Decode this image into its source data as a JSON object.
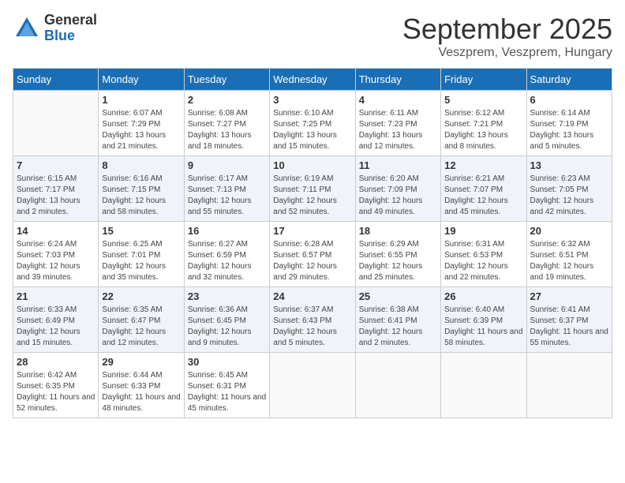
{
  "logo": {
    "general": "General",
    "blue": "Blue"
  },
  "header": {
    "month": "September 2025",
    "location": "Veszprem, Veszprem, Hungary"
  },
  "weekdays": [
    "Sunday",
    "Monday",
    "Tuesday",
    "Wednesday",
    "Thursday",
    "Friday",
    "Saturday"
  ],
  "weeks": [
    [
      {
        "day": "",
        "sunrise": "",
        "sunset": "",
        "daylight": ""
      },
      {
        "day": "1",
        "sunrise": "Sunrise: 6:07 AM",
        "sunset": "Sunset: 7:29 PM",
        "daylight": "Daylight: 13 hours and 21 minutes."
      },
      {
        "day": "2",
        "sunrise": "Sunrise: 6:08 AM",
        "sunset": "Sunset: 7:27 PM",
        "daylight": "Daylight: 13 hours and 18 minutes."
      },
      {
        "day": "3",
        "sunrise": "Sunrise: 6:10 AM",
        "sunset": "Sunset: 7:25 PM",
        "daylight": "Daylight: 13 hours and 15 minutes."
      },
      {
        "day": "4",
        "sunrise": "Sunrise: 6:11 AM",
        "sunset": "Sunset: 7:23 PM",
        "daylight": "Daylight: 13 hours and 12 minutes."
      },
      {
        "day": "5",
        "sunrise": "Sunrise: 6:12 AM",
        "sunset": "Sunset: 7:21 PM",
        "daylight": "Daylight: 13 hours and 8 minutes."
      },
      {
        "day": "6",
        "sunrise": "Sunrise: 6:14 AM",
        "sunset": "Sunset: 7:19 PM",
        "daylight": "Daylight: 13 hours and 5 minutes."
      }
    ],
    [
      {
        "day": "7",
        "sunrise": "Sunrise: 6:15 AM",
        "sunset": "Sunset: 7:17 PM",
        "daylight": "Daylight: 13 hours and 2 minutes."
      },
      {
        "day": "8",
        "sunrise": "Sunrise: 6:16 AM",
        "sunset": "Sunset: 7:15 PM",
        "daylight": "Daylight: 12 hours and 58 minutes."
      },
      {
        "day": "9",
        "sunrise": "Sunrise: 6:17 AM",
        "sunset": "Sunset: 7:13 PM",
        "daylight": "Daylight: 12 hours and 55 minutes."
      },
      {
        "day": "10",
        "sunrise": "Sunrise: 6:19 AM",
        "sunset": "Sunset: 7:11 PM",
        "daylight": "Daylight: 12 hours and 52 minutes."
      },
      {
        "day": "11",
        "sunrise": "Sunrise: 6:20 AM",
        "sunset": "Sunset: 7:09 PM",
        "daylight": "Daylight: 12 hours and 49 minutes."
      },
      {
        "day": "12",
        "sunrise": "Sunrise: 6:21 AM",
        "sunset": "Sunset: 7:07 PM",
        "daylight": "Daylight: 12 hours and 45 minutes."
      },
      {
        "day": "13",
        "sunrise": "Sunrise: 6:23 AM",
        "sunset": "Sunset: 7:05 PM",
        "daylight": "Daylight: 12 hours and 42 minutes."
      }
    ],
    [
      {
        "day": "14",
        "sunrise": "Sunrise: 6:24 AM",
        "sunset": "Sunset: 7:03 PM",
        "daylight": "Daylight: 12 hours and 39 minutes."
      },
      {
        "day": "15",
        "sunrise": "Sunrise: 6:25 AM",
        "sunset": "Sunset: 7:01 PM",
        "daylight": "Daylight: 12 hours and 35 minutes."
      },
      {
        "day": "16",
        "sunrise": "Sunrise: 6:27 AM",
        "sunset": "Sunset: 6:59 PM",
        "daylight": "Daylight: 12 hours and 32 minutes."
      },
      {
        "day": "17",
        "sunrise": "Sunrise: 6:28 AM",
        "sunset": "Sunset: 6:57 PM",
        "daylight": "Daylight: 12 hours and 29 minutes."
      },
      {
        "day": "18",
        "sunrise": "Sunrise: 6:29 AM",
        "sunset": "Sunset: 6:55 PM",
        "daylight": "Daylight: 12 hours and 25 minutes."
      },
      {
        "day": "19",
        "sunrise": "Sunrise: 6:31 AM",
        "sunset": "Sunset: 6:53 PM",
        "daylight": "Daylight: 12 hours and 22 minutes."
      },
      {
        "day": "20",
        "sunrise": "Sunrise: 6:32 AM",
        "sunset": "Sunset: 6:51 PM",
        "daylight": "Daylight: 12 hours and 19 minutes."
      }
    ],
    [
      {
        "day": "21",
        "sunrise": "Sunrise: 6:33 AM",
        "sunset": "Sunset: 6:49 PM",
        "daylight": "Daylight: 12 hours and 15 minutes."
      },
      {
        "day": "22",
        "sunrise": "Sunrise: 6:35 AM",
        "sunset": "Sunset: 6:47 PM",
        "daylight": "Daylight: 12 hours and 12 minutes."
      },
      {
        "day": "23",
        "sunrise": "Sunrise: 6:36 AM",
        "sunset": "Sunset: 6:45 PM",
        "daylight": "Daylight: 12 hours and 9 minutes."
      },
      {
        "day": "24",
        "sunrise": "Sunrise: 6:37 AM",
        "sunset": "Sunset: 6:43 PM",
        "daylight": "Daylight: 12 hours and 5 minutes."
      },
      {
        "day": "25",
        "sunrise": "Sunrise: 6:38 AM",
        "sunset": "Sunset: 6:41 PM",
        "daylight": "Daylight: 12 hours and 2 minutes."
      },
      {
        "day": "26",
        "sunrise": "Sunrise: 6:40 AM",
        "sunset": "Sunset: 6:39 PM",
        "daylight": "Daylight: 11 hours and 58 minutes."
      },
      {
        "day": "27",
        "sunrise": "Sunrise: 6:41 AM",
        "sunset": "Sunset: 6:37 PM",
        "daylight": "Daylight: 11 hours and 55 minutes."
      }
    ],
    [
      {
        "day": "28",
        "sunrise": "Sunrise: 6:42 AM",
        "sunset": "Sunset: 6:35 PM",
        "daylight": "Daylight: 11 hours and 52 minutes."
      },
      {
        "day": "29",
        "sunrise": "Sunrise: 6:44 AM",
        "sunset": "Sunset: 6:33 PM",
        "daylight": "Daylight: 11 hours and 48 minutes."
      },
      {
        "day": "30",
        "sunrise": "Sunrise: 6:45 AM",
        "sunset": "Sunset: 6:31 PM",
        "daylight": "Daylight: 11 hours and 45 minutes."
      },
      {
        "day": "",
        "sunrise": "",
        "sunset": "",
        "daylight": ""
      },
      {
        "day": "",
        "sunrise": "",
        "sunset": "",
        "daylight": ""
      },
      {
        "day": "",
        "sunrise": "",
        "sunset": "",
        "daylight": ""
      },
      {
        "day": "",
        "sunrise": "",
        "sunset": "",
        "daylight": ""
      }
    ]
  ]
}
